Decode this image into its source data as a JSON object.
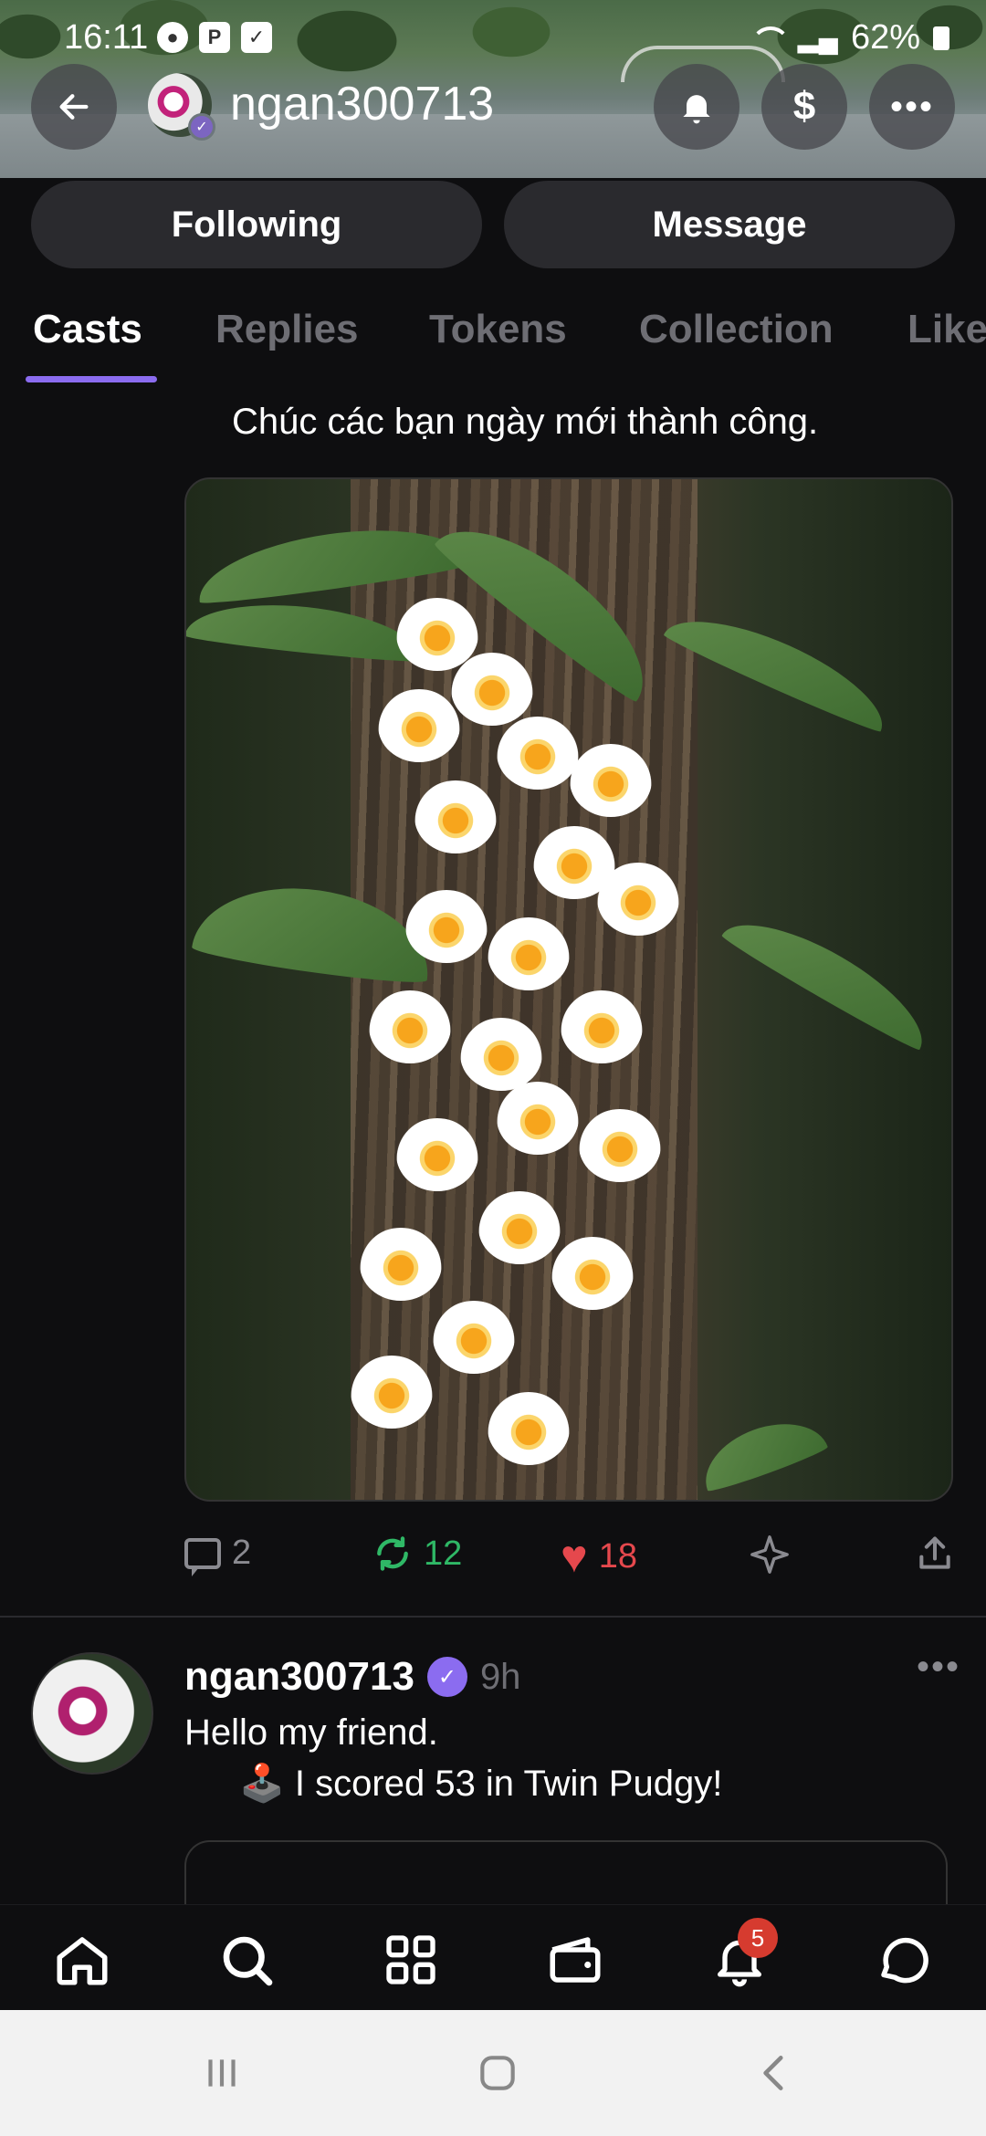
{
  "status_bar": {
    "time": "16:11",
    "battery": "62%"
  },
  "header": {
    "username": "ngan300713",
    "back_icon": "arrow-left-icon",
    "bell_icon": "bell-icon",
    "tip_label": "$",
    "more_label": "•••"
  },
  "actions": {
    "following_label": "Following",
    "message_label": "Message"
  },
  "tabs": [
    "Casts",
    "Replies",
    "Tokens",
    "Collection",
    "Likes"
  ],
  "active_tab": "Casts",
  "post1": {
    "text": "Chúc các bạn ngày mới thành công.",
    "replies": "2",
    "recasts": "12",
    "likes": "18"
  },
  "post2": {
    "username": "ngan300713",
    "time": "9h",
    "more_label": "•••",
    "line1": "Hello my friend.",
    "line2": "🕹️ I scored 53 in Twin Pudgy!"
  },
  "bottom_nav": {
    "notifications_count": "5"
  },
  "colors": {
    "accent": "#8b6cf0",
    "recast": "#2fb866",
    "like": "#e5484d",
    "background": "#0e0e10"
  }
}
